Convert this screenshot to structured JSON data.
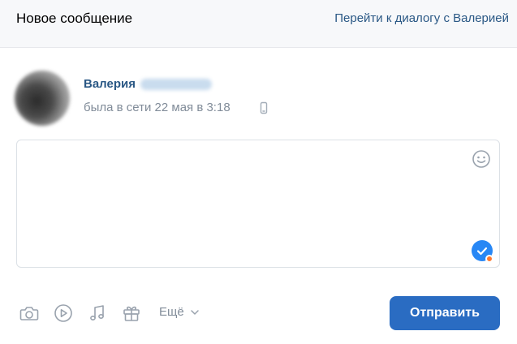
{
  "header": {
    "title": "Новое сообщение",
    "go_to_dialog_link": "Перейти к диалогу с Валерией"
  },
  "recipient": {
    "first_name": "Валерия",
    "status": "была в сети 22 мая в 3:18",
    "status_device_icon": "phone-icon"
  },
  "composer": {
    "text": "",
    "emoji_icon": "smile-icon",
    "check_icon": "checkmark-icon"
  },
  "toolbar": {
    "icons": [
      "camera-icon",
      "video-play-icon",
      "music-note-icon",
      "gift-icon"
    ],
    "more_label": "Ещё",
    "send_label": "Отправить"
  },
  "colors": {
    "link": "#2a5885",
    "muted_text": "#818c99",
    "send_button": "#2a6cc2",
    "check_badge": "#2787f5",
    "notification_dot": "#ff7a2f",
    "header_bg": "#f7f8fa"
  }
}
